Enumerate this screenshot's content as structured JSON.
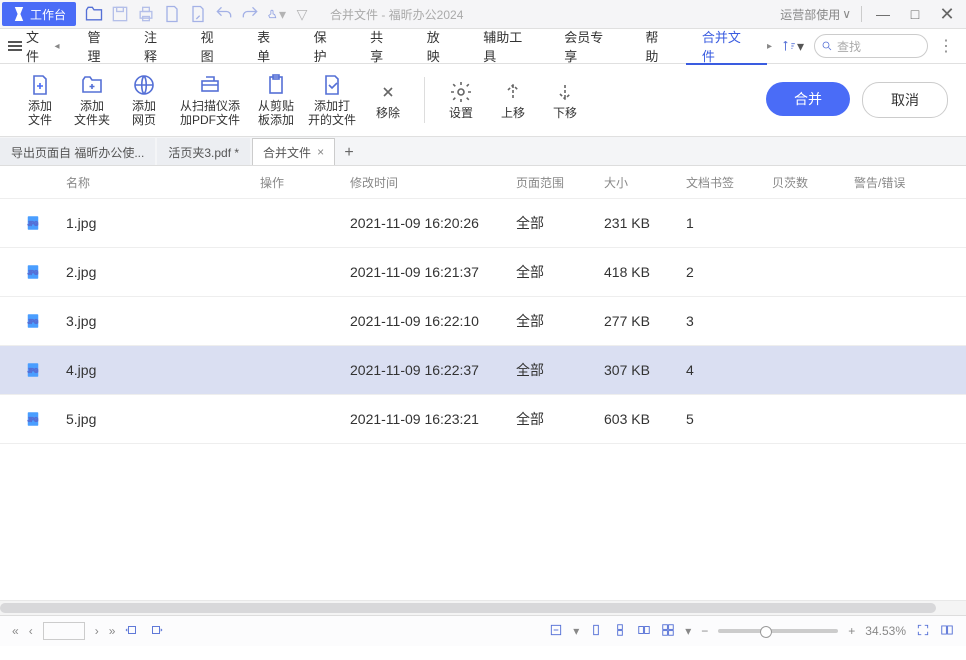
{
  "titlebar": {
    "workspace": "工作台",
    "title": "合并文件 - 福昕办公2024",
    "usage": "运营部使用"
  },
  "menu": {
    "file": "文件",
    "items": [
      "管理",
      "注释",
      "视图",
      "表单",
      "保护",
      "共享",
      "放映",
      "辅助工具",
      "会员专享",
      "帮助",
      "合并文件"
    ],
    "active_index": 10,
    "search_placeholder": "查找"
  },
  "toolbar": {
    "add_file": "添加\n文件",
    "add_folder": "添加\n文件夹",
    "add_web": "添加\n网页",
    "from_scanner": "从扫描仪添\n加PDF文件",
    "from_clipboard": "从剪贴\n板添加",
    "add_open": "添加打\n开的文件",
    "remove": "移除",
    "settings": "设置",
    "move_up": "上移",
    "move_down": "下移",
    "merge": "合并",
    "cancel": "取消"
  },
  "tabs": {
    "items": [
      {
        "label": "导出页面自 福昕办公使..."
      },
      {
        "label": "活页夹3.pdf *"
      },
      {
        "label": "合并文件",
        "active": true
      }
    ]
  },
  "table": {
    "headers": {
      "name": "名称",
      "op": "操作",
      "time": "修改时间",
      "range": "页面范围",
      "size": "大小",
      "bookmark": "文档书签",
      "bates": "贝茨数",
      "warn": "警告/错误"
    },
    "rows": [
      {
        "name": "1.jpg",
        "time": "2021-11-09 16:20:26",
        "range": "全部",
        "size": "231 KB",
        "book": "1"
      },
      {
        "name": "2.jpg",
        "time": "2021-11-09 16:21:37",
        "range": "全部",
        "size": "418 KB",
        "book": "2"
      },
      {
        "name": "3.jpg",
        "time": "2021-11-09 16:22:10",
        "range": "全部",
        "size": "277 KB",
        "book": "3"
      },
      {
        "name": "4.jpg",
        "time": "2021-11-09 16:22:37",
        "range": "全部",
        "size": "307 KB",
        "book": "4",
        "selected": true
      },
      {
        "name": "5.jpg",
        "time": "2021-11-09 16:23:21",
        "range": "全部",
        "size": "603 KB",
        "book": "5"
      }
    ]
  },
  "status": {
    "zoom": "34.53%"
  }
}
